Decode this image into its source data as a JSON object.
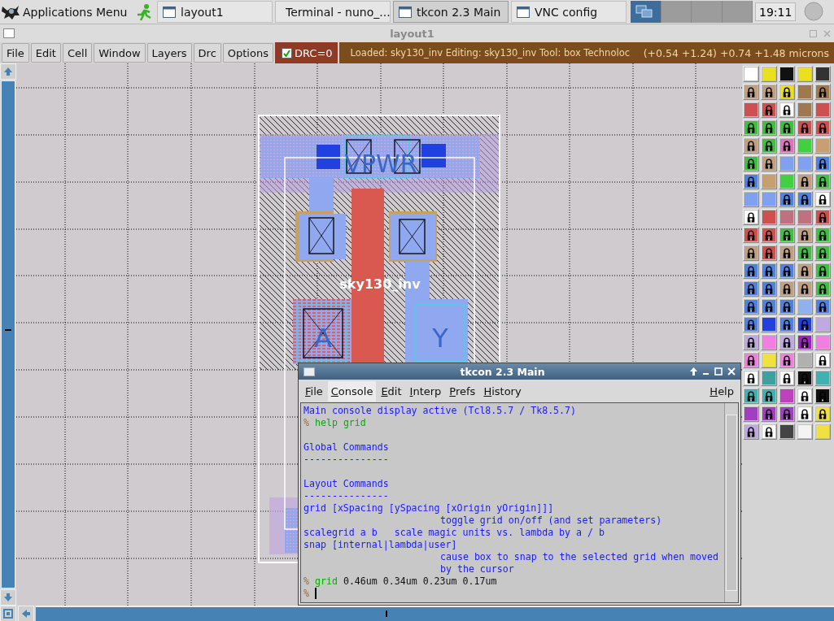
{
  "taskbar": {
    "menu_label": "Applications Menu",
    "tasks": [
      {
        "label": "layout1",
        "kind": "window",
        "selected": false
      },
      {
        "label": "Terminal - nuno_...",
        "kind": "terminal",
        "selected": false
      },
      {
        "label": "tkcon 2.3 Main",
        "kind": "window",
        "selected": true
      },
      {
        "label": "VNC config",
        "kind": "window",
        "selected": false
      }
    ],
    "desktops": [
      {
        "selected": true
      },
      {
        "selected": false
      },
      {
        "selected": false
      },
      {
        "selected": false
      }
    ],
    "clock": "19:11"
  },
  "window": {
    "title": "layout1"
  },
  "menu": [
    "File",
    "Edit",
    "Cell",
    "Window",
    "Layers",
    "Drc",
    "Options"
  ],
  "drc": {
    "label": "DRC=0",
    "checked": true
  },
  "status": "Loaded: sky130_inv Editing: sky130_inv Tool: box  Technoloc",
  "coordinates": "(+0.54 +1.24) +0.74 +1.48 microns",
  "layout": {
    "labels": [
      {
        "text": "VPWR",
        "kind": "port"
      },
      {
        "text": "sky130_inv",
        "kind": "cell"
      },
      {
        "text": "A",
        "kind": "port"
      },
      {
        "text": "Y",
        "kind": "port"
      }
    ]
  },
  "palette": [
    [
      {
        "color": "#ffffff",
        "locked": false
      },
      {
        "color": "#e8e020",
        "locked": false
      },
      {
        "color": "#111111",
        "locked": false
      },
      {
        "color": "#e8e020",
        "locked": false
      },
      {
        "color": "#333333",
        "locked": false
      }
    ],
    [
      {
        "color": "#c0a080",
        "locked": true
      },
      {
        "color": "#c0a080",
        "locked": true
      },
      {
        "color": "#e8e020",
        "locked": true
      },
      {
        "color": "#a07850",
        "locked": false
      },
      {
        "color": "#a07850",
        "locked": true
      }
    ],
    [
      {
        "color": "#d05050",
        "locked": false
      },
      {
        "color": "#d05050",
        "locked": true
      },
      {
        "color": "#ffffff",
        "locked": true
      },
      {
        "color": "#a07850",
        "locked": false
      },
      {
        "color": "#d05050",
        "locked": false
      }
    ],
    [
      {
        "color": "#40c040",
        "locked": true
      },
      {
        "color": "#40c040",
        "locked": true
      },
      {
        "color": "#40c040",
        "locked": true
      },
      {
        "color": "#d05050",
        "locked": true
      },
      {
        "color": "#d05050",
        "locked": true
      }
    ],
    [
      {
        "color": "#c0a080",
        "locked": true
      },
      {
        "color": "#40c040",
        "locked": true
      },
      {
        "color": "#e070c0",
        "locked": true
      },
      {
        "color": "#40d040",
        "locked": false
      },
      {
        "color": "#c8a070",
        "locked": false
      }
    ],
    [
      {
        "color": "#40c040",
        "locked": true
      },
      {
        "color": "#c0a080",
        "locked": true
      },
      {
        "color": "#80a0f0",
        "locked": false
      },
      {
        "color": "#80a0f0",
        "locked": false
      },
      {
        "color": "#5080e0",
        "locked": true
      }
    ],
    [
      {
        "color": "#5080e0",
        "locked": true
      },
      {
        "color": "#c8a070",
        "locked": false
      },
      {
        "color": "#40d040",
        "locked": false
      },
      {
        "color": "#c0a080",
        "locked": true
      },
      {
        "color": "#40c040",
        "locked": true
      }
    ],
    [
      {
        "color": "#80a0f0",
        "locked": false
      },
      {
        "color": "#80a0f0",
        "locked": false
      },
      {
        "color": "#5080e0",
        "locked": true
      },
      {
        "color": "#5080e0",
        "locked": true
      },
      {
        "color": "#ffffff",
        "locked": true
      }
    ],
    [
      {
        "color": "#ffffff",
        "locked": true
      },
      {
        "color": "#d05050",
        "locked": false
      },
      {
        "color": "#c07080",
        "locked": false
      },
      {
        "color": "#c07080",
        "locked": false
      },
      {
        "color": "#d05050",
        "locked": true
      }
    ],
    [
      {
        "color": "#d05050",
        "locked": true
      },
      {
        "color": "#d05050",
        "locked": true
      },
      {
        "color": "#40c040",
        "locked": true
      },
      {
        "color": "#c0a080",
        "locked": true
      },
      {
        "color": "#40c040",
        "locked": true
      }
    ],
    [
      {
        "color": "#c0a080",
        "locked": true
      },
      {
        "color": "#d05050",
        "locked": true
      },
      {
        "color": "#c0a080",
        "locked": true
      },
      {
        "color": "#40c040",
        "locked": true
      },
      {
        "color": "#40c040",
        "locked": true
      }
    ],
    [
      {
        "color": "#5080e0",
        "locked": true
      },
      {
        "color": "#5080e0",
        "locked": true
      },
      {
        "color": "#5080e0",
        "locked": true
      },
      {
        "color": "#c0a080",
        "locked": true
      },
      {
        "color": "#40c040",
        "locked": true
      }
    ],
    [
      {
        "color": "#5080e0",
        "locked": true
      },
      {
        "color": "#5080e0",
        "locked": true
      },
      {
        "color": "#c0a080",
        "locked": true
      },
      {
        "color": "#c0a080",
        "locked": true
      },
      {
        "color": "#40c040",
        "locked": true
      }
    ],
    [
      {
        "color": "#5080e0",
        "locked": true
      },
      {
        "color": "#5080e0",
        "locked": true
      },
      {
        "color": "#5080e0",
        "locked": true
      },
      {
        "color": "#90b0f0",
        "locked": false
      },
      {
        "color": "#5080e0",
        "locked": true
      }
    ],
    [
      {
        "color": "#5080e0",
        "locked": true
      },
      {
        "color": "#2040e0",
        "locked": false
      },
      {
        "color": "#5080e0",
        "locked": true
      },
      {
        "color": "#2040e0",
        "locked": true
      },
      {
        "color": "#c0a8e0",
        "locked": false
      }
    ],
    [
      {
        "color": "#c0a8e0",
        "locked": true
      },
      {
        "color": "#f080e0",
        "locked": false
      },
      {
        "color": "#c0a8e0",
        "locked": true
      },
      {
        "color": "#a020c0",
        "locked": true
      },
      {
        "color": "#f080e0",
        "locked": false
      }
    ],
    [
      {
        "color": "#f080e0",
        "locked": true
      },
      {
        "color": "#f0e040",
        "locked": false
      },
      {
        "color": "#f080e0",
        "locked": true
      },
      {
        "color": "#b0b0b0",
        "locked": false
      },
      {
        "color": "#ffffff",
        "locked": true
      }
    ],
    [
      {
        "color": "#ffffff",
        "locked": true
      },
      {
        "color": "#40a0a0",
        "locked": false
      },
      {
        "color": "#ffffff",
        "locked": true
      },
      {
        "color": "#111111",
        "locked": true
      },
      {
        "color": "#40b0b0",
        "locked": false
      }
    ],
    [
      {
        "color": "#40b0b0",
        "locked": true
      },
      {
        "color": "#40b0b0",
        "locked": true
      },
      {
        "color": "#c040c0",
        "locked": false
      },
      {
        "color": "#ffffff",
        "locked": true
      },
      {
        "color": "#111111",
        "locked": true
      }
    ],
    [
      {
        "color": "#a040c0",
        "locked": false
      },
      {
        "color": "#a040c0",
        "locked": true
      },
      {
        "color": "#a040c0",
        "locked": true
      },
      {
        "color": "#ffffff",
        "locked": true
      },
      {
        "color": "#f0e040",
        "locked": true
      }
    ],
    [
      {
        "color": "#c0a8e0",
        "locked": true
      },
      {
        "color": "#ffffff",
        "locked": true
      },
      {
        "color": "#444444",
        "locked": false
      },
      {
        "color": "#f4f4f4",
        "locked": false
      },
      {
        "color": "#f0e040",
        "locked": false
      }
    ]
  ],
  "console_window": {
    "title": "tkcon 2.3 Main",
    "menu": [
      {
        "label": "File",
        "selected": false
      },
      {
        "label": "Console",
        "selected": true
      },
      {
        "label": "Edit",
        "selected": false
      },
      {
        "label": "Interp",
        "selected": false
      },
      {
        "label": "Prefs",
        "selected": false
      },
      {
        "label": "History",
        "selected": false
      }
    ],
    "help": "Help",
    "lines": [
      {
        "kind": "plain",
        "segments": [
          {
            "kind": "info",
            "text": "Main console display active (Tcl8.5.7 / Tk8.5.7)"
          }
        ]
      },
      {
        "kind": "plain",
        "segments": [
          {
            "kind": "prompt",
            "text": "%"
          },
          {
            "kind": "command",
            "text": "help grid"
          }
        ]
      },
      {
        "kind": "blank"
      },
      {
        "kind": "plain",
        "segments": [
          {
            "kind": "info",
            "text": "Global Commands"
          }
        ]
      },
      {
        "kind": "plain",
        "segments": [
          {
            "kind": "info",
            "text": "---------------"
          }
        ]
      },
      {
        "kind": "blank"
      },
      {
        "kind": "plain",
        "segments": [
          {
            "kind": "info",
            "text": "Layout Commands"
          }
        ]
      },
      {
        "kind": "plain",
        "segments": [
          {
            "kind": "info",
            "text": "---------------"
          }
        ]
      },
      {
        "kind": "plain",
        "segments": [
          {
            "kind": "info",
            "text": "grid [xSpacing [ySpacing [xOrigin yOrigin]]]"
          }
        ]
      },
      {
        "kind": "indented",
        "segments": [
          {
            "kind": "info",
            "text": "toggle grid on/off (and set parameters)"
          }
        ]
      },
      {
        "kind": "plain",
        "segments": [
          {
            "kind": "info",
            "text": "scalegrid a b   scale magic units vs. lambda by a / b"
          }
        ]
      },
      {
        "kind": "plain",
        "segments": [
          {
            "kind": "info",
            "text": "snap [internal|lambda|user]"
          }
        ]
      },
      {
        "kind": "indented",
        "segments": [
          {
            "kind": "info",
            "text": "cause box to snap to the selected grid when moved"
          }
        ]
      },
      {
        "kind": "indented",
        "segments": [
          {
            "kind": "info",
            "text": "by the cursor"
          }
        ]
      },
      {
        "kind": "plain",
        "segments": [
          {
            "kind": "prompt",
            "text": "%"
          },
          {
            "kind": "command",
            "text": "grid"
          },
          {
            "kind": "output",
            "text": "0.46um 0.34um 0.23um 0.17um"
          }
        ]
      },
      {
        "kind": "input",
        "segments": [
          {
            "kind": "prompt",
            "text": "%"
          }
        ]
      }
    ]
  }
}
